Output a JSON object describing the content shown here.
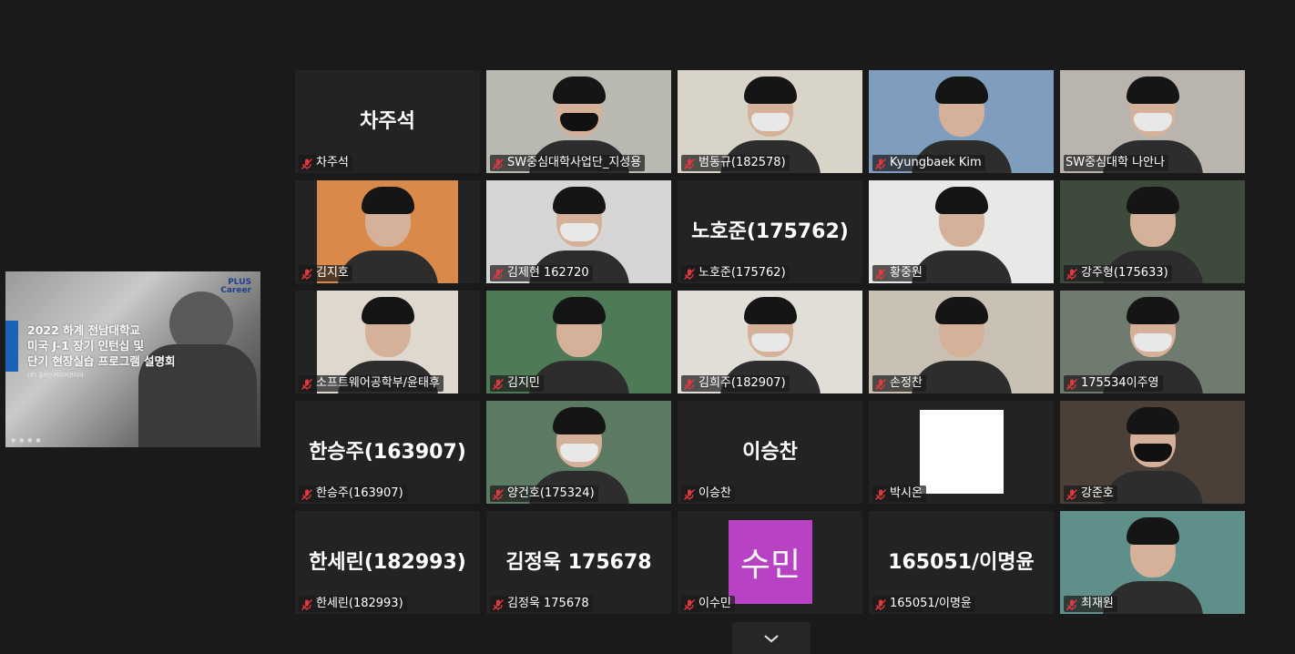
{
  "shared_screen": {
    "logo": [
      "PLUS",
      "Career"
    ],
    "title_lines": [
      "2022 하계 전남대학교",
      "미국 J-1 장기 인턴십 및",
      "단기 현장실습 프로그램 설명회"
    ],
    "subtitle": "(주) 플러스커리어코리아"
  },
  "colors": {
    "background": "#1a1a1a",
    "tile_bg": "#232323",
    "active_speaker": "#d7f055",
    "mic_muted": "#e0383e",
    "avatar_bg": "#b842c4"
  },
  "participants": [
    {
      "name": "차주석",
      "big": "차주석",
      "muted": true
    },
    {
      "name": "SW중심대학사업단_지성용",
      "muted": true,
      "video": true,
      "bg": "#b9b9b2",
      "mask": "black"
    },
    {
      "name": "범동규(182578)",
      "muted": true,
      "video": true,
      "bg": "#d9d4c8",
      "mask": "white"
    },
    {
      "name": "Kyungbaek Kim",
      "muted": true,
      "video": true,
      "bg": "#7f9dbc",
      "mask": "none"
    },
    {
      "name": "SW중심대학 나안나",
      "muted": false,
      "video": true,
      "bg": "#b9b5ae",
      "mask": "white",
      "active": true
    },
    {
      "name": "김지호",
      "muted": true,
      "video": true,
      "bg": "#d98a4a",
      "mask": "none"
    },
    {
      "name": "김제현 162720",
      "muted": true,
      "video": true,
      "bg": "#d6d6d6",
      "mask": "white"
    },
    {
      "name": "노호준(175762)",
      "big": "노호준(175762)",
      "muted": true
    },
    {
      "name": "황중원",
      "muted": true,
      "video": true,
      "bg": "#e8e8e6",
      "mask": "none"
    },
    {
      "name": "강주형(175633)",
      "muted": true,
      "video": true,
      "bg": "#3e4a3c",
      "mask": "none"
    },
    {
      "name": "소프트웨어공학부/윤태후",
      "muted": true,
      "video": true,
      "bg": "#ded8cf",
      "mask": "none"
    },
    {
      "name": "김지민",
      "muted": true,
      "video": true,
      "bg": "#4f7a58",
      "mask": "none"
    },
    {
      "name": "김희주(182907)",
      "muted": true,
      "video": true,
      "bg": "#e1ded8",
      "mask": "white"
    },
    {
      "name": "손정찬",
      "muted": true,
      "video": true,
      "bg": "#c9c1b4",
      "mask": "none"
    },
    {
      "name": "175534이주영",
      "muted": true,
      "video": true,
      "bg": "#6f7b6f",
      "mask": "white"
    },
    {
      "name": "한승주(163907)",
      "big": "한승주(163907)",
      "muted": true
    },
    {
      "name": "양건호(175324)",
      "muted": true,
      "video": true,
      "bg": "#5c7a62",
      "mask": "white"
    },
    {
      "name": "이승찬",
      "big": "이승찬",
      "muted": true
    },
    {
      "name": "박시온",
      "muted": true,
      "whitebox": true
    },
    {
      "name": "강준호",
      "muted": true,
      "video": true,
      "bg": "#4a4038",
      "mask": "black"
    },
    {
      "name": "한세린(182993)",
      "big": "한세린(182993)",
      "muted": true
    },
    {
      "name": "김정욱 175678",
      "big": "김정욱 175678",
      "muted": true
    },
    {
      "name": "이수민",
      "avatar": "수민",
      "muted": true
    },
    {
      "name": "165051/이명윤",
      "big": "165051/이명윤",
      "muted": true
    },
    {
      "name": "최재원",
      "muted": true,
      "video": true,
      "bg": "#5f8f8a",
      "mask": "none"
    }
  ],
  "controls": {
    "more_videos": "chevron-down"
  }
}
